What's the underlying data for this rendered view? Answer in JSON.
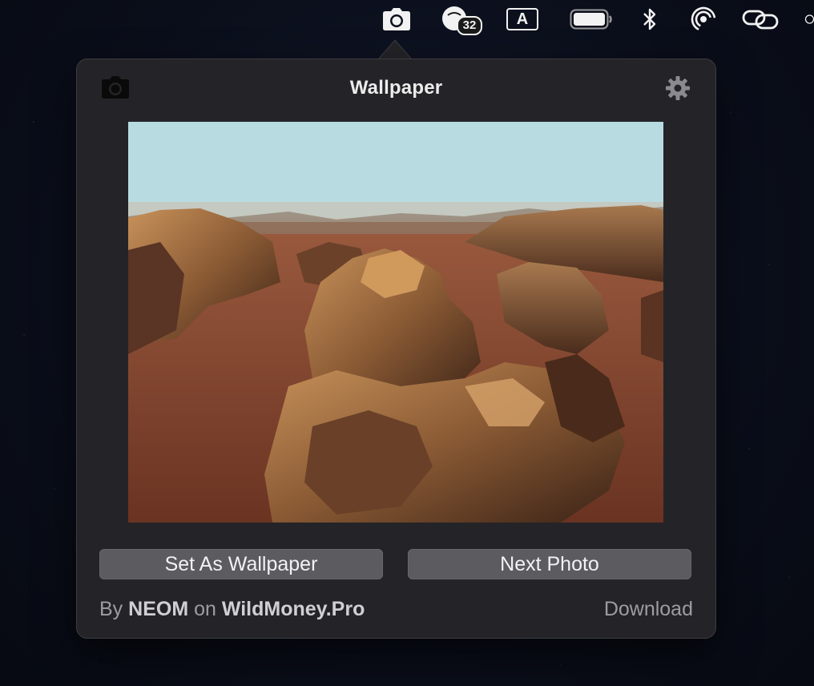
{
  "menubar": {
    "notification_count": "32",
    "input_source": "A"
  },
  "popover": {
    "title": "Wallpaper",
    "set_wallpaper_label": "Set As Wallpaper",
    "next_photo_label": "Next Photo",
    "credit_prefix": "By",
    "author": "NEOM",
    "credit_middle": "on",
    "site": "WildMoney.Pro",
    "download_label": "Download"
  },
  "icons": {
    "menubar": [
      "camera-icon",
      "notification-badge-icon",
      "input-source-icon",
      "battery-icon",
      "bluetooth-icon",
      "airdrop-icon",
      "link-icon"
    ],
    "popover": [
      "camera-icon",
      "gear-icon"
    ]
  },
  "colors": {
    "popover_bg": "#242428",
    "button_bg": "#5b5b60",
    "text_primary": "#ececec",
    "text_secondary": "#9c9ca2"
  }
}
